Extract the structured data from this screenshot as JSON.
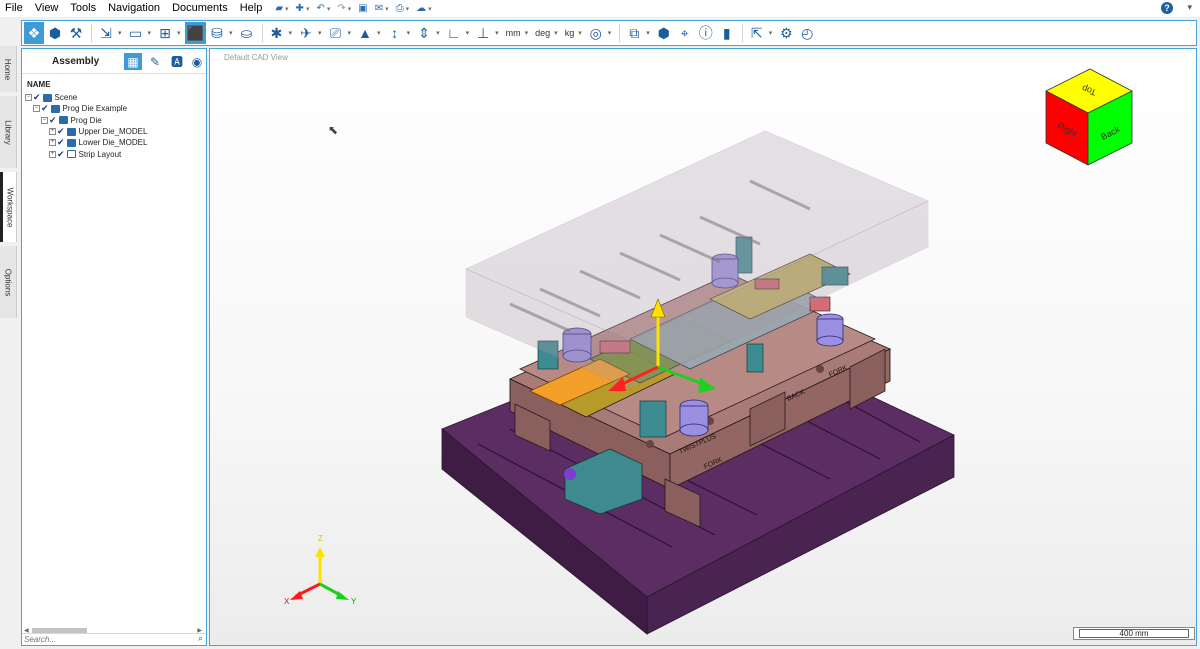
{
  "menu": {
    "items": [
      "File",
      "View",
      "Tools",
      "Navigation",
      "Documents",
      "Help"
    ]
  },
  "toolbar": {
    "unit_length": "mm",
    "unit_angle": "deg",
    "unit_mass": "kg"
  },
  "side_tabs": [
    "Home",
    "Library",
    "Workspace",
    "Options"
  ],
  "panel": {
    "title": "Assembly",
    "column_header": "NAME",
    "tree": [
      {
        "label": "Scene",
        "level": 0
      },
      {
        "label": "Prog Die Example",
        "level": 1
      },
      {
        "label": "Prog Die",
        "level": 2
      },
      {
        "label": "Upper Die_MODEL",
        "level": 3
      },
      {
        "label": "Lower Die_MODEL",
        "level": 3
      },
      {
        "label": "Strip Layout",
        "level": 3
      }
    ],
    "search_placeholder": "Search..."
  },
  "viewport": {
    "view_label": "Default CAD View",
    "scale_label": "400 mm",
    "triad_labels": {
      "x": "X",
      "y": "Y",
      "z": "Z"
    },
    "nav_cube": {
      "top": "Top",
      "right": "Right",
      "back": "Back"
    },
    "engravings": [
      "TWISTPLUS",
      "FORK",
      "BACK",
      "FORK"
    ],
    "colors": {
      "cube_top": "#ffff00",
      "cube_right": "#ff0000",
      "cube_back": "#00ff00",
      "base": "#4a2450",
      "die_shoe": "#a97b78"
    }
  }
}
